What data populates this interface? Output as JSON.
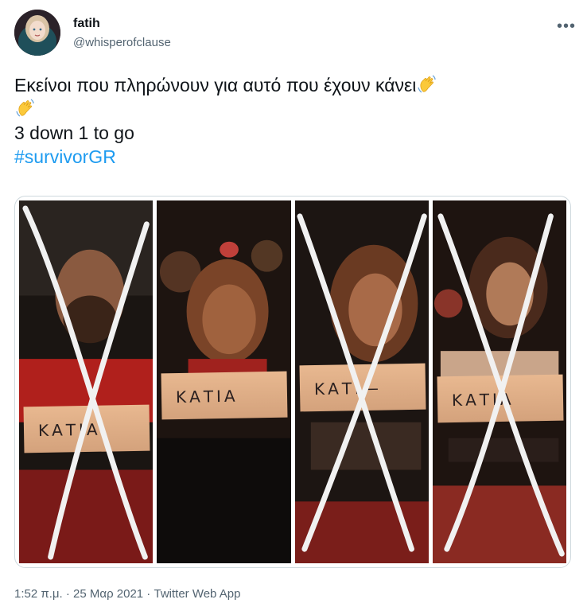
{
  "user": {
    "display_name": "fatih",
    "handle": "@whisperofclause"
  },
  "tweet": {
    "line1": "Εκείνοι που πληρώνουν για αυτό που έχουν κάνει",
    "line2": "3 down 1 to go",
    "hashtag": "#survivorGR",
    "emoji": "waving-hand-emoji"
  },
  "media": {
    "panels": [
      {
        "sign_text": "ΚΑΤΙΑ",
        "crossed": true
      },
      {
        "sign_text": "ΚΑΤΙΑ",
        "crossed": false
      },
      {
        "sign_text": "ΚΑΤΙ—",
        "crossed": true
      },
      {
        "sign_text": "ΚΑΤΙΑ",
        "crossed": true
      }
    ]
  },
  "meta": {
    "time": "1:52 π.μ.",
    "separator1": " · ",
    "date": "25 Μαρ 2021",
    "separator2": " · ",
    "app": "Twitter Web App"
  },
  "icons": {
    "more": "more-horizontal-icon"
  },
  "colors": {
    "link": "#1d9bf0",
    "text": "#0f1419",
    "secondary": "#536471",
    "border": "#cfd9de"
  }
}
